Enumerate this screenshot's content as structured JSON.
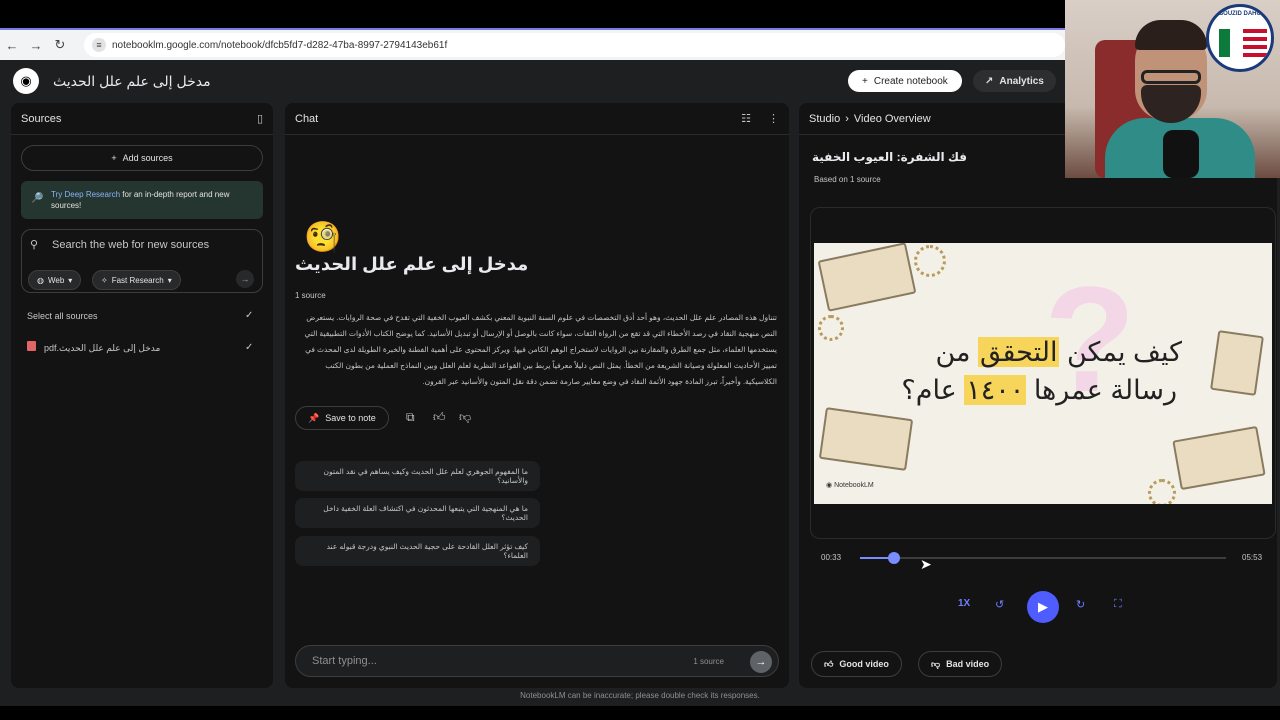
{
  "browser": {
    "url": "notebooklm.google.com/notebook/dfcb5fd7-d282-47ba-8997-2794143eb61f"
  },
  "app": {
    "title": "مدخل إلى علم علل الحديث",
    "create_label": "Create notebook",
    "analytics_label": "Analytics"
  },
  "sources": {
    "title": "Sources",
    "add_label": "Add sources",
    "deep_link": "Try Deep Research",
    "deep_text": " for an in-depth report and new sources!",
    "search_placeholder": "Search the web for new sources",
    "chip_web": "Web",
    "chip_research": "Fast Research",
    "select_all": "Select all sources",
    "file_name": "مدخل إلى علم علل الحديث.pdf"
  },
  "chat": {
    "title": "Chat",
    "emoji": "🧐",
    "notebook_title": "مدخل إلى علم علل الحديث",
    "source_count": "1 source",
    "summary": "تتناول هذه المصادر علم علل الحديث، وهو أحد أدق التخصصات في علوم السنة النبوية المعني بكشف العيوب الخفية التي تقدح في صحة الروايات. يستعرض النص منهجية النقاد في رصد الأخطاء التي قد تقع من الرواة الثقات، سواء كانت بالوصل أو الإرسال أو تبديل الأسانيد. كما يوضح الكتاب الأدوات التطبيقية التي يستخدمها العلماء، مثل جمع الطرق والمقارنة بين الروايات لاستخراج الوهم الكامن فيها. ويركز المحتوى على أهمية الفطنة والخبرة الطويلة لدى المحدث في تمييز الأحاديث المعلولة وصيانة الشريعة من الخطأ. يمثل النص دليلاً معرفياً يربط بين القواعد النظرية لعلم العلل وبين النماذج العملية من بطون الكتب الكلاسيكية. وأخيراً، تبرز المادة جهود الأئمة النقاد في وضع معايير صارمة تضمن دقة نقل المتون والأسانيد عبر القرون.",
    "save_note": "Save to note",
    "suggestions": [
      "ما المفهوم الجوهري لعلم علل الحديث وكيف يساهم في نقد المتون والأسانيد؟",
      "ما هي المنهجية التي يتبعها المحدثون في اكتشاف العلة الخفية داخل الحديث؟",
      "كيف تؤثر العلل القادحة على حجية الحديث النبوي ودرجة قبوله عند العلماء؟"
    ],
    "input_placeholder": "Start typing...",
    "input_count": "1 source"
  },
  "studio": {
    "crumb_root": "Studio",
    "crumb_page": "Video Overview",
    "video_title": "فك الشفرة: العيوب الخفية",
    "based_on": "Based on 1 source",
    "slide_line1_pre": "كيف يمكن ",
    "slide_line1_hl": "التحقق",
    "slide_line1_post": " من",
    "slide_line2_pre": "رسالة عمرها ",
    "slide_line2_hl": "١٤٠٠",
    "slide_line2_post": " عام؟",
    "slide_brand": "NotebookLM",
    "time_current": "00:33",
    "time_duration": "05:53",
    "progress_fraction": 0.093,
    "speed_label": "1X",
    "good_label": "Good video",
    "bad_label": "Bad video"
  },
  "footer": {
    "disclaimer": "NotebookLM can be inaccurate; please double check its responses."
  },
  "overlay": {
    "seal_text": "BOUZID DAHO"
  },
  "colors": {
    "accent": "#4f5cff",
    "background": "#131314"
  }
}
